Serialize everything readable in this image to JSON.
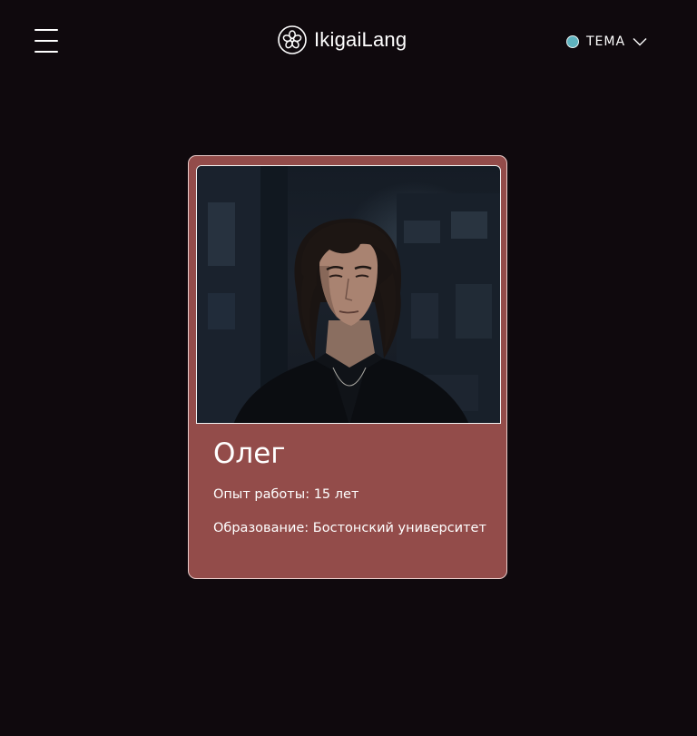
{
  "header": {
    "menu_icon": "hamburger-menu-icon",
    "brand": {
      "name": "IkigaiLang",
      "logo_icon": "flower-logo-icon"
    },
    "theme": {
      "label": "ТЕМА",
      "dot_color": "#5fb3bf",
      "chevron_icon": "chevron-down-icon"
    }
  },
  "card": {
    "background_color": "#934c4a",
    "photo_description_icon": "person-photo",
    "name": "Олег",
    "experience": "Опыт работы: 15 лет",
    "education": "Образование: Бостонский университет"
  },
  "page": {
    "background_color": "#0f090d"
  }
}
